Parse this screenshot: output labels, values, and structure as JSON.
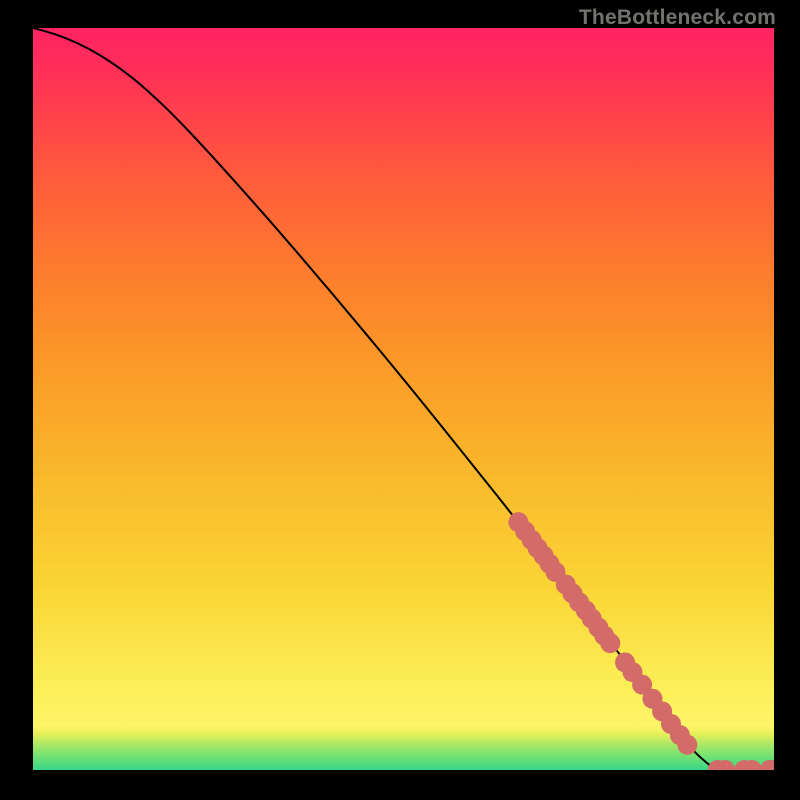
{
  "watermark": "TheBottleneck.com",
  "chart_data": {
    "type": "line",
    "title": "",
    "xlabel": "",
    "ylabel": "",
    "xlim": [
      0,
      100
    ],
    "ylim": [
      0,
      100
    ],
    "grid": false,
    "legend": false,
    "series": [
      {
        "name": "curve",
        "x": [
          0,
          3,
          6,
          9,
          12,
          15,
          20,
          30,
          40,
          50,
          60,
          65,
          70,
          75,
          80,
          85,
          88,
          91,
          92.5,
          94,
          96,
          97.5,
          99,
          100
        ],
        "y": [
          100,
          99.2,
          98.0,
          96.4,
          94.4,
          92.0,
          87.3,
          76.3,
          64.7,
          52.7,
          40.3,
          34.0,
          27.6,
          21.1,
          14.5,
          7.8,
          3.7,
          0.8,
          0,
          0,
          0,
          0,
          0,
          0
        ]
      },
      {
        "name": "markers-upper-cluster",
        "x": [
          65.5,
          66.4,
          67.3,
          68.1,
          68.9,
          69.7,
          70.5
        ],
        "y": [
          33.4,
          32.2,
          31.0,
          29.9,
          28.9,
          27.8,
          26.7
        ]
      },
      {
        "name": "markers-mid-cluster",
        "x": [
          71.9,
          72.8,
          73.7,
          74.6,
          75.4,
          76.3,
          77.1,
          77.9
        ],
        "y": [
          25.0,
          23.8,
          22.6,
          21.5,
          20.4,
          19.2,
          18.1,
          17.1
        ]
      },
      {
        "name": "markers-lower-cluster",
        "x": [
          79.9,
          80.9,
          82.2,
          83.6,
          84.9,
          86.1,
          87.3,
          88.3
        ],
        "y": [
          14.5,
          13.2,
          11.5,
          9.6,
          7.9,
          6.2,
          4.7,
          3.4
        ]
      },
      {
        "name": "markers-bottom",
        "x": [
          92.4,
          93.4,
          96.0,
          97.0,
          99.4,
          100
        ],
        "y": [
          0,
          0,
          0,
          0,
          0,
          0
        ]
      }
    ],
    "colors": {
      "curve": "#000000",
      "markers": "#d36b68"
    },
    "background_gradient": [
      "#ff2363",
      "#ff5b3c",
      "#fb9928",
      "#fad636",
      "#fff568",
      "#e8f059",
      "#58dd7c",
      "#39d688"
    ]
  }
}
